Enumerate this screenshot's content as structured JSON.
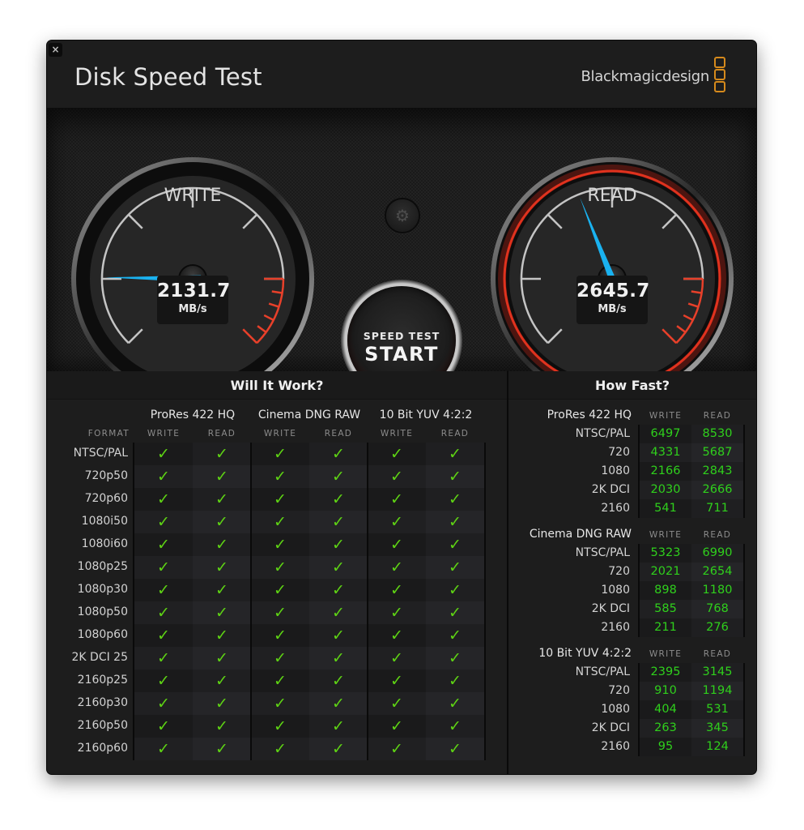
{
  "window": {
    "title": "Disk Speed Test",
    "brand": "Blackmagicdesign",
    "close_icon": "×",
    "accent_color": "#e0321e",
    "needle_color": "#1ab2f0",
    "check_color": "#5ed314",
    "number_color": "#2fd01c"
  },
  "gauges": {
    "write": {
      "label": "WRITE",
      "value": "2131.7",
      "unit": "MB/s",
      "needle_fraction": 0.17
    },
    "read": {
      "label": "READ",
      "value": "2645.7",
      "unit": "MB/s",
      "needle_fraction": 0.42
    }
  },
  "controls": {
    "settings_icon": "⚙",
    "start_top": "SPEED TEST",
    "start_main": "START"
  },
  "will_it_work": {
    "title": "Will It Work?",
    "format_header": "FORMAT",
    "codecs": [
      "ProRes 422 HQ",
      "Cinema DNG RAW",
      "10 Bit YUV 4:2:2"
    ],
    "subheaders": [
      "WRITE",
      "READ",
      "WRITE",
      "READ",
      "WRITE",
      "READ"
    ],
    "check_icon": "✓",
    "rows": [
      {
        "format": "NTSC/PAL",
        "results": [
          true,
          true,
          true,
          true,
          true,
          true
        ]
      },
      {
        "format": "720p50",
        "results": [
          true,
          true,
          true,
          true,
          true,
          true
        ]
      },
      {
        "format": "720p60",
        "results": [
          true,
          true,
          true,
          true,
          true,
          true
        ]
      },
      {
        "format": "1080i50",
        "results": [
          true,
          true,
          true,
          true,
          true,
          true
        ]
      },
      {
        "format": "1080i60",
        "results": [
          true,
          true,
          true,
          true,
          true,
          true
        ]
      },
      {
        "format": "1080p25",
        "results": [
          true,
          true,
          true,
          true,
          true,
          true
        ]
      },
      {
        "format": "1080p30",
        "results": [
          true,
          true,
          true,
          true,
          true,
          true
        ]
      },
      {
        "format": "1080p50",
        "results": [
          true,
          true,
          true,
          true,
          true,
          true
        ]
      },
      {
        "format": "1080p60",
        "results": [
          true,
          true,
          true,
          true,
          true,
          true
        ]
      },
      {
        "format": "2K DCI 25",
        "results": [
          true,
          true,
          true,
          true,
          true,
          true
        ]
      },
      {
        "format": "2160p25",
        "results": [
          true,
          true,
          true,
          true,
          true,
          true
        ]
      },
      {
        "format": "2160p30",
        "results": [
          true,
          true,
          true,
          true,
          true,
          true
        ]
      },
      {
        "format": "2160p50",
        "results": [
          true,
          true,
          true,
          true,
          true,
          true
        ]
      },
      {
        "format": "2160p60",
        "results": [
          true,
          true,
          true,
          true,
          true,
          true
        ]
      }
    ]
  },
  "how_fast": {
    "title": "How Fast?",
    "write_header": "WRITE",
    "read_header": "READ",
    "groups": [
      {
        "codec": "ProRes 422 HQ",
        "rows": [
          {
            "format": "NTSC/PAL",
            "write": "6497",
            "read": "8530"
          },
          {
            "format": "720",
            "write": "4331",
            "read": "5687"
          },
          {
            "format": "1080",
            "write": "2166",
            "read": "2843"
          },
          {
            "format": "2K DCI",
            "write": "2030",
            "read": "2666"
          },
          {
            "format": "2160",
            "write": "541",
            "read": "711"
          }
        ]
      },
      {
        "codec": "Cinema DNG RAW",
        "rows": [
          {
            "format": "NTSC/PAL",
            "write": "5323",
            "read": "6990"
          },
          {
            "format": "720",
            "write": "2021",
            "read": "2654"
          },
          {
            "format": "1080",
            "write": "898",
            "read": "1180"
          },
          {
            "format": "2K DCI",
            "write": "585",
            "read": "768"
          },
          {
            "format": "2160",
            "write": "211",
            "read": "276"
          }
        ]
      },
      {
        "codec": "10 Bit YUV 4:2:2",
        "rows": [
          {
            "format": "NTSC/PAL",
            "write": "2395",
            "read": "3145"
          },
          {
            "format": "720",
            "write": "910",
            "read": "1194"
          },
          {
            "format": "1080",
            "write": "404",
            "read": "531"
          },
          {
            "format": "2K DCI",
            "write": "263",
            "read": "345"
          },
          {
            "format": "2160",
            "write": "95",
            "read": "124"
          }
        ]
      }
    ]
  }
}
